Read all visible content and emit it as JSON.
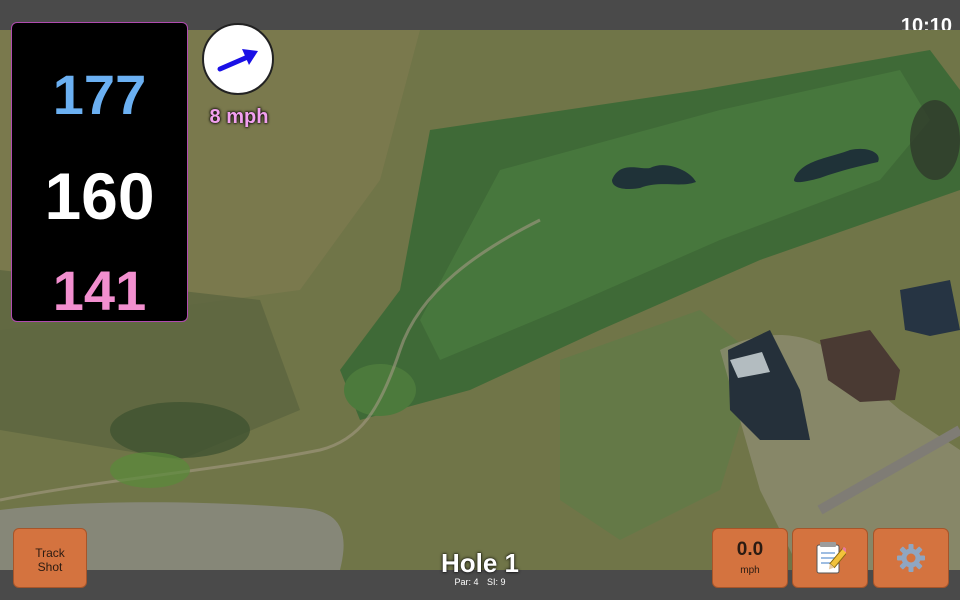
{
  "status_bar": {
    "time": "10:10"
  },
  "distances": {
    "back": {
      "value": "177",
      "color": "#6bb0f2"
    },
    "middle": {
      "value": "160",
      "color": "#ffffff"
    },
    "front": {
      "value": "141",
      "color": "#f28fcf"
    }
  },
  "wind": {
    "speed": "8 mph",
    "arrow_icon": "arrow-right-up-icon",
    "arrow_color": "#1a10e6"
  },
  "hole": {
    "title": "Hole 1",
    "par": "Par: 4",
    "si": "SI: 9"
  },
  "buttons": {
    "track_shot": {
      "line1": "Track",
      "line2": "Shot"
    },
    "speed": {
      "value": "0.0",
      "unit": "mph"
    },
    "notes": {
      "icon": "notepad-pencil-icon"
    },
    "settings": {
      "icon": "gear-icon"
    }
  },
  "colors": {
    "button": "#d4733f",
    "panel_border": "#b04bb0"
  }
}
